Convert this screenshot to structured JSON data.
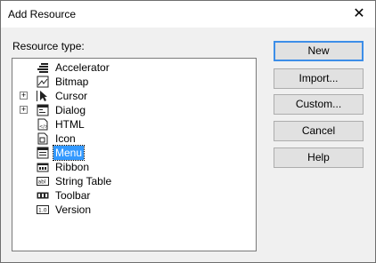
{
  "window": {
    "title": "Add Resource",
    "close_glyph": "✕"
  },
  "resource_type_label": "Resource type:",
  "tree": {
    "items": [
      {
        "label": "Accelerator",
        "expandable": false,
        "icon": "accelerator-icon"
      },
      {
        "label": "Bitmap",
        "expandable": false,
        "icon": "bitmap-icon"
      },
      {
        "label": "Cursor",
        "expandable": true,
        "icon": "cursor-icon"
      },
      {
        "label": "Dialog",
        "expandable": true,
        "icon": "dialog-icon"
      },
      {
        "label": "HTML",
        "expandable": false,
        "icon": "html-icon"
      },
      {
        "label": "Icon",
        "expandable": false,
        "icon": "icon-icon"
      },
      {
        "label": "Menu",
        "expandable": false,
        "icon": "menu-icon",
        "selected": true
      },
      {
        "label": "Ribbon",
        "expandable": false,
        "icon": "ribbon-icon"
      },
      {
        "label": "String Table",
        "expandable": false,
        "icon": "string-table-icon"
      },
      {
        "label": "Toolbar",
        "expandable": false,
        "icon": "toolbar-icon"
      },
      {
        "label": "Version",
        "expandable": false,
        "icon": "version-icon"
      }
    ]
  },
  "buttons": {
    "new": "New",
    "import": "Import...",
    "custom": "Custom...",
    "cancel": "Cancel",
    "help": "Help"
  }
}
